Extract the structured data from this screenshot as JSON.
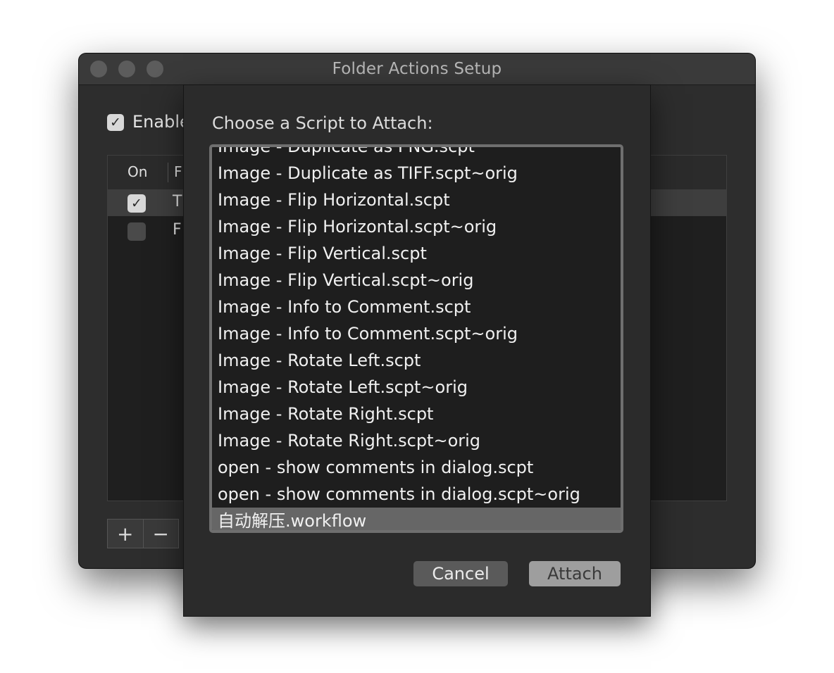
{
  "window": {
    "title": "Folder Actions Setup"
  },
  "main": {
    "enable_label": "Enable",
    "enable_checked": true,
    "table": {
      "columns": [
        "On",
        "F"
      ],
      "rows": [
        {
          "on": true,
          "name": "T",
          "selected": true
        },
        {
          "on": false,
          "name": "F",
          "selected": false
        }
      ]
    },
    "add_label": "+",
    "remove_label": "−"
  },
  "sheet": {
    "prompt": "Choose a Script to Attach:",
    "items": [
      "Image - Duplicate as PNG.scpt",
      "Image - Duplicate as TIFF.scpt~orig",
      "Image - Flip Horizontal.scpt",
      "Image - Flip Horizontal.scpt~orig",
      "Image - Flip Vertical.scpt",
      "Image - Flip Vertical.scpt~orig",
      "Image - Info to Comment.scpt",
      "Image - Info to Comment.scpt~orig",
      "Image - Rotate Left.scpt",
      "Image - Rotate Left.scpt~orig",
      "Image - Rotate Right.scpt",
      "Image - Rotate Right.scpt~orig",
      "open - show comments in dialog.scpt",
      "open - show comments in dialog.scpt~orig",
      "自动解压.workflow"
    ],
    "selected_index": 14,
    "cancel_label": "Cancel",
    "attach_label": "Attach"
  }
}
